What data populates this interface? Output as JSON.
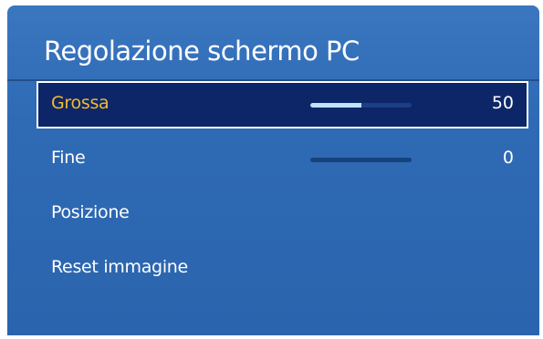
{
  "menu": {
    "title": "Regolazione schermo PC",
    "items": [
      {
        "label": "Grossa",
        "value": "50",
        "slider_fraction": 0.5,
        "selected": true
      },
      {
        "label": "Fine",
        "value": "0",
        "slider_fraction": 0.0,
        "selected": false
      },
      {
        "label": "Posizione"
      },
      {
        "label": "Reset immagine"
      }
    ]
  },
  "colors": {
    "panel_background": "#2f6ab5",
    "selected_background": "#0d2668",
    "selected_label": "#f4b92e",
    "text": "#ffffff",
    "slider_fill": "#bfe3ff"
  }
}
